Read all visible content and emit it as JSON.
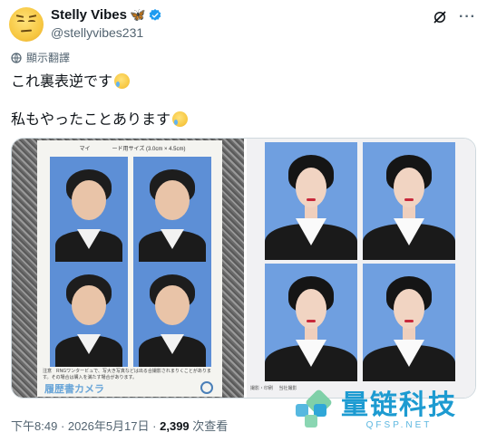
{
  "author": {
    "display_name": "Stelly Vibes",
    "handle": "@stellyvibes231"
  },
  "translate_label": "顯示翻譯",
  "post": {
    "line1": "これ裏表逆です",
    "line2": "私もやったことあります"
  },
  "media": {
    "left_sheet_title": "マイ　　　　ード用サイズ (3.0cm × 4.5cm)",
    "left_sheet_foot": "注意　RNGワンタービュで、写大き写真などは出る合撮影されまりくことがあります。その場合は購入を満たす場合があります。",
    "left_sheet_brand": "履歴書カメラ",
    "right_sheet_foot": "撮影・印刷　 当社撮影 "
  },
  "meta": {
    "time": "下午8:49",
    "date": "2026年5月17日",
    "separator": "·",
    "views": "2,399",
    "views_label": "次查看"
  },
  "watermark": {
    "name": "量链科技",
    "domain": "QFSP.NET"
  },
  "colors": {
    "accent": "#1d9bf0",
    "text_secondary": "#536471",
    "watermark": "#1d9bd1"
  }
}
